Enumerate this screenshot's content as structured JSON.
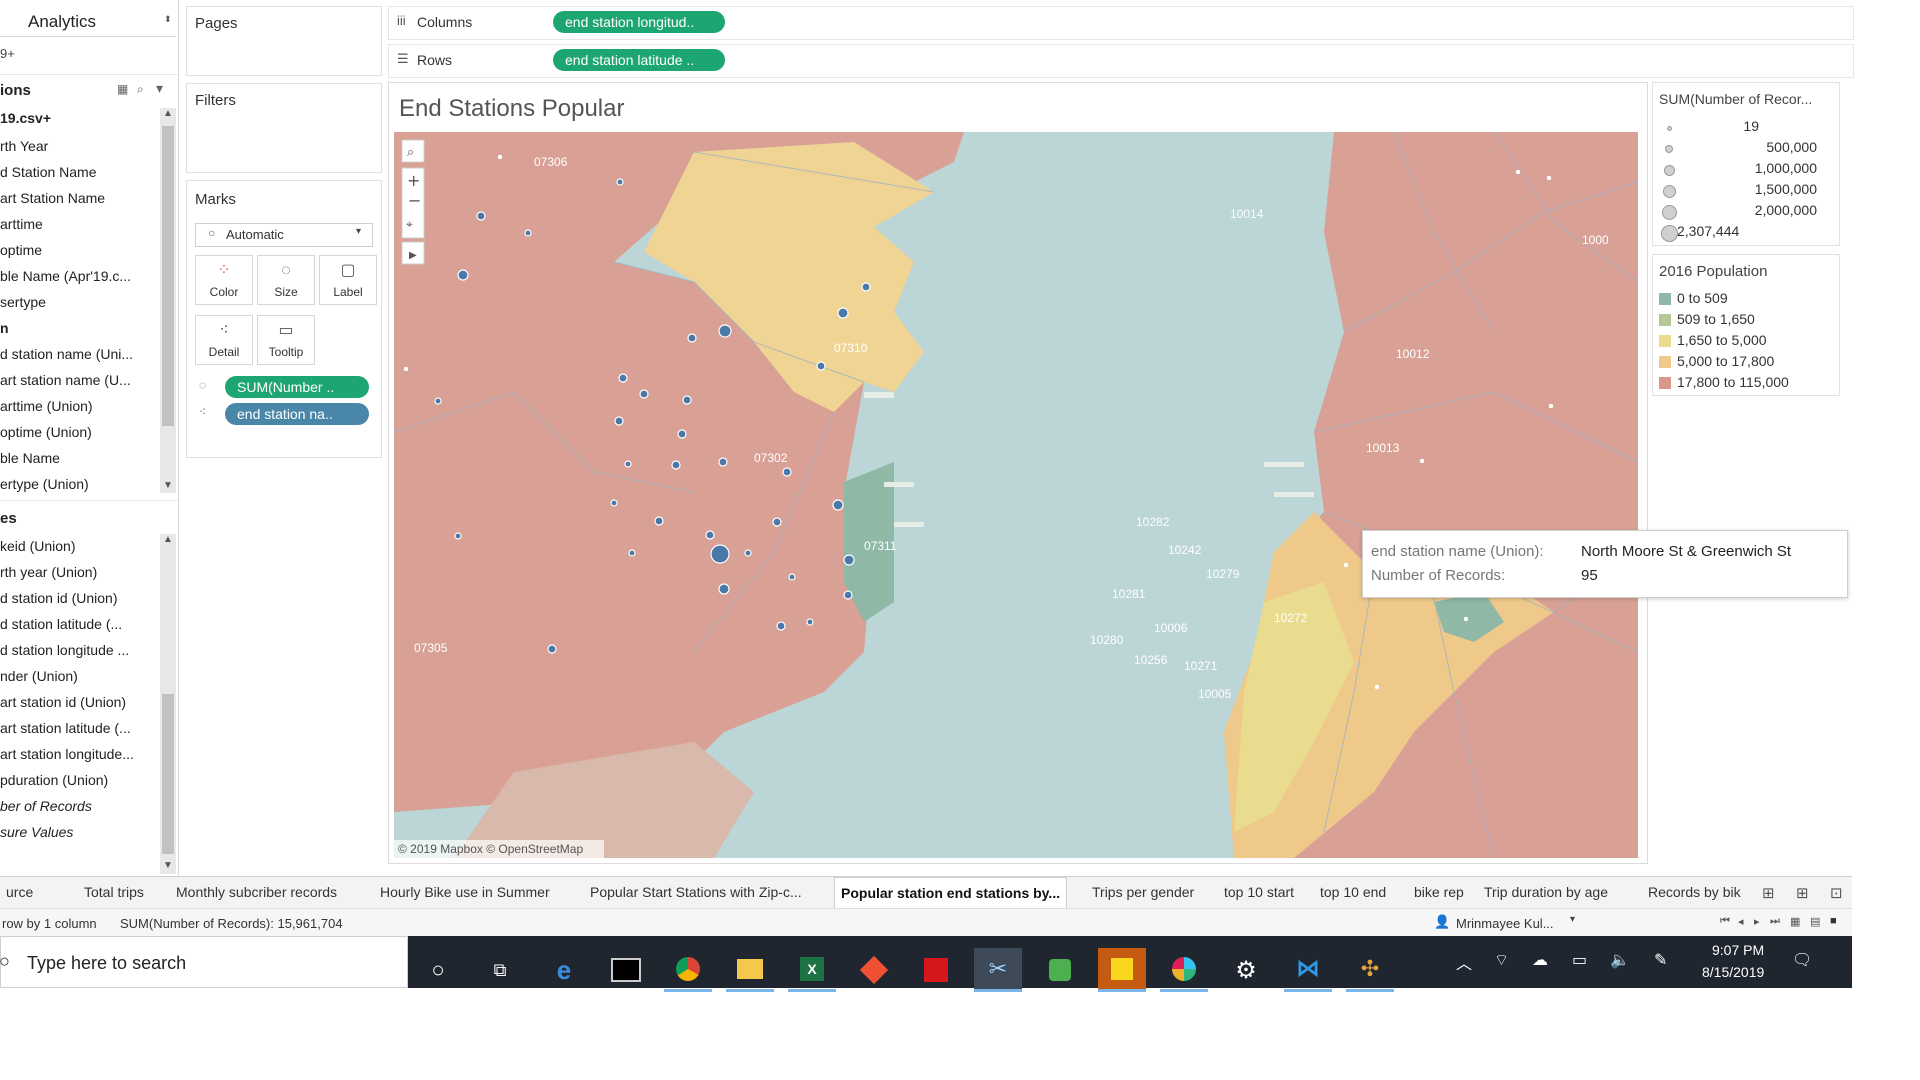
{
  "left_panel": {
    "dropdown_label": "Analytics",
    "count_text": "9+",
    "header_title": "ions",
    "datasource": "19.csv+",
    "dimension_fields": [
      "rth Year",
      "d Station Name",
      "art Station Name",
      "arttime",
      "optime",
      "ble Name (Apr'19.c...",
      "sertype",
      "n",
      "d station name (Uni...",
      "art station name (U...",
      "arttime (Union)",
      "optime (Union)",
      "ble Name",
      "ertype (Union)"
    ],
    "measures_header": "es",
    "measure_fields": [
      "keid (Union)",
      "rth year (Union)",
      "d station id (Union)",
      "d station latitude (...",
      "d station longitude ...",
      "nder (Union)",
      "art station id (Union)",
      "art station latitude (...",
      "art station longitude...",
      "pduration (Union)",
      "ber of Records",
      "sure Values"
    ]
  },
  "shelves": {
    "pages_label": "Pages",
    "filters_label": "Filters",
    "marks_label": "Marks",
    "mark_type": "Automatic",
    "mark_buttons": [
      "Color",
      "Size",
      "Label",
      "Detail",
      "Tooltip"
    ],
    "mark_pills": [
      "SUM(Number ..",
      "end station na.."
    ],
    "columns_label": "Columns",
    "columns_pill": "end station longitud..",
    "rows_label": "Rows",
    "rows_pill": "end station latitude .."
  },
  "viz": {
    "title": "End Stations Popular",
    "attribution": "© 2019 Mapbox © OpenStreetMap",
    "map_labels": [
      "07306",
      "07310",
      "07302",
      "07311",
      "07305",
      "10014",
      "1000",
      "10012",
      "10013",
      "10282",
      "10242",
      "10279",
      "10281",
      "10280",
      "10006",
      "10256",
      "10271",
      "10005",
      "10272",
      "07303"
    ],
    "tooltip": {
      "field1_label": "end station name (Union):",
      "field1_value": "North Moore St & Greenwich St",
      "field2_label": "Number of Records:",
      "field2_value": "95"
    }
  },
  "legends": {
    "size_title": "SUM(Number of Recor...",
    "size_items": [
      "19",
      "500,000",
      "1,000,000",
      "1,500,000",
      "2,000,000",
      "2,307,444"
    ],
    "color_title": "2016 Population",
    "color_items": [
      {
        "label": "0 to 509",
        "color": "#8fb8a6"
      },
      {
        "label": "509 to 1,650",
        "color": "#b5c794"
      },
      {
        "label": "1,650 to 5,000",
        "color": "#e9dc8e"
      },
      {
        "label": "5,000 to 17,800",
        "color": "#efc98a"
      },
      {
        "label": "17,800 to 115,000",
        "color": "#d9978c"
      }
    ]
  },
  "sheet_tabs": [
    "urce",
    "Total trips",
    "Monthly subcriber records",
    "Hourly Bike use in Summer",
    "Popular Start Stations with Zip-c...",
    "Popular station end stations by...",
    "Trips per gender",
    "top 10 start",
    "top 10 end",
    "bike rep",
    "Trip duration by age",
    "Records by bik"
  ],
  "active_tab_index": 5,
  "status_bar": {
    "rows_info": "row by 1 column",
    "sum_info": "SUM(Number of Records): 15,961,704",
    "user": "Mrinmayee Kul..."
  },
  "taskbar": {
    "search_placeholder": "Type here to search",
    "time": "9:07 PM",
    "date": "8/15/2019"
  },
  "colors": {
    "pill_green": "#1ea672",
    "pill_blue": "#4a86a8",
    "water": "#bcd5d7",
    "land_high": "#d9978c",
    "land_mid": "#efc98a",
    "taskbar_bg": "#1f2630",
    "dot": "#4a78a8"
  }
}
